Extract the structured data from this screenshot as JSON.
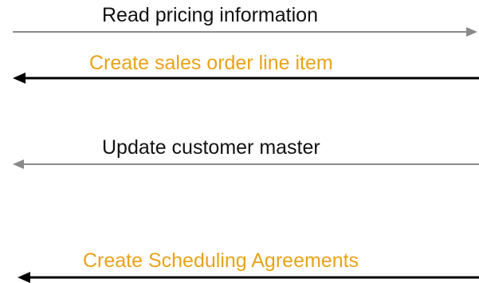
{
  "colors": {
    "black": "#000000",
    "gray": "#8a8a8a",
    "orange": "#e8a317",
    "dark_text": "#111111"
  },
  "flows": [
    {
      "label": "Read pricing information",
      "direction": "right",
      "line_color": "#8a8a8a",
      "text_color": "#111111"
    },
    {
      "label": "Create sales order line item",
      "direction": "left",
      "line_color": "#000000",
      "text_color": "#e8a317"
    },
    {
      "label": "Update customer master",
      "direction": "left",
      "line_color": "#8a8a8a",
      "text_color": "#111111"
    },
    {
      "label": "Create Scheduling Agreements",
      "direction": "left",
      "line_color": "#000000",
      "text_color": "#e8a317"
    }
  ]
}
